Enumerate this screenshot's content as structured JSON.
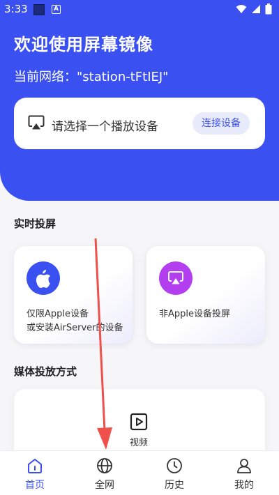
{
  "status_bar": {
    "time": "3:33",
    "a_badge": "A"
  },
  "hero": {
    "title": "欢迎使用屏幕镜像",
    "network_label": "当前网络：\"station-tFtIEJ\""
  },
  "device": {
    "prompt": "请选择一个播放设备",
    "connect_label": "连接设备"
  },
  "realtime": {
    "section_title": "实时投屏",
    "cards": [
      {
        "line1": "仅限Apple设备",
        "line2": "或安装AirServer的设备"
      },
      {
        "line1": "非Apple设备投屏"
      }
    ]
  },
  "media": {
    "section_title": "媒体投放方式",
    "video_label": "视频"
  },
  "tabs": [
    {
      "label": "首页",
      "icon": "home-icon",
      "active": true
    },
    {
      "label": "全网",
      "icon": "globe-icon"
    },
    {
      "label": "历史",
      "icon": "clock-icon"
    },
    {
      "label": "我的",
      "icon": "user-icon"
    }
  ],
  "colors": {
    "primary": "#3a50f0",
    "apple_circle": "#3a50f0",
    "cast_circle": "#b33ef0",
    "arrow": "#f0504a"
  }
}
